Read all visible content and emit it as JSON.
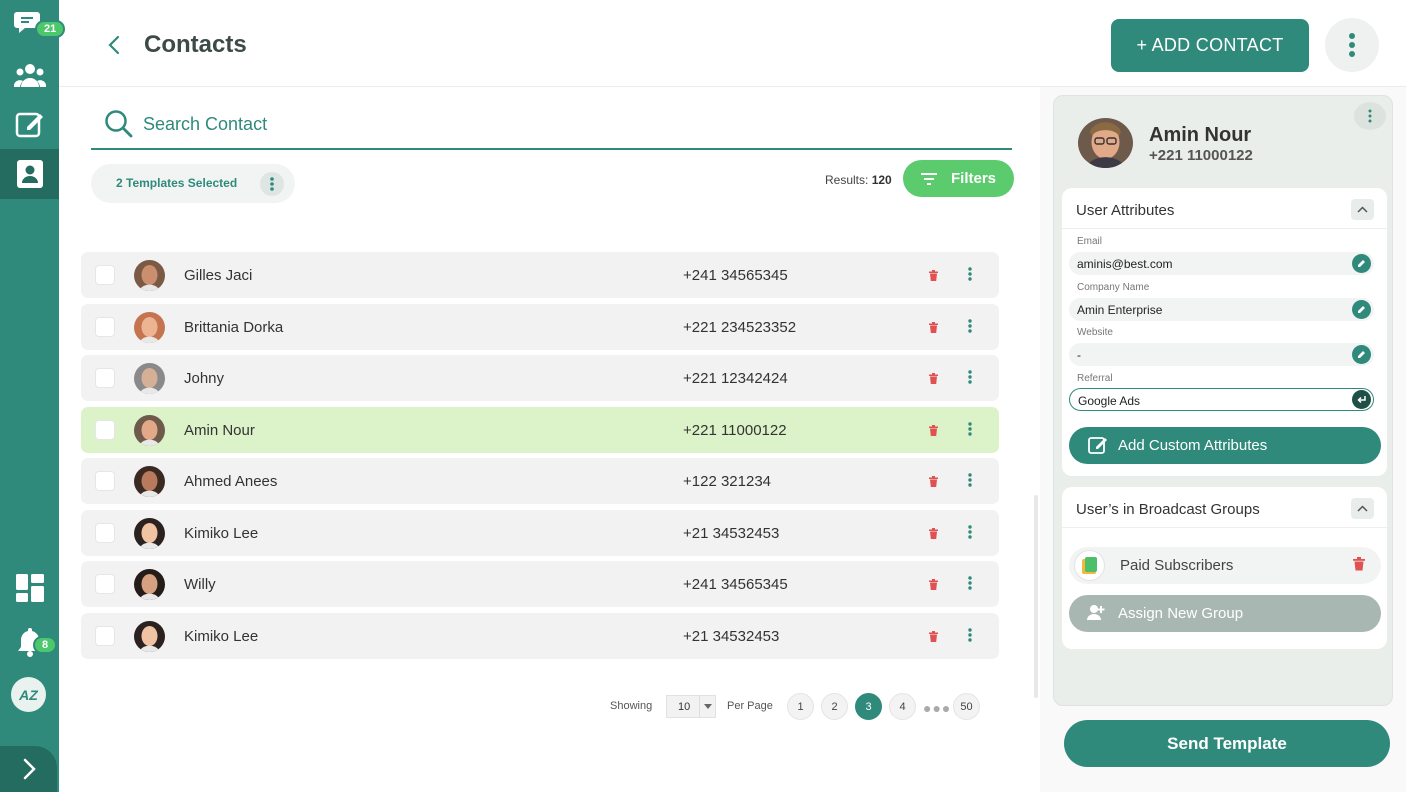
{
  "sidebar": {
    "chat_badge": "21",
    "notifications_badge": "8",
    "brand_initials": "AZ"
  },
  "header": {
    "title": "Contacts",
    "add_contact_label": "+ ADD CONTACT"
  },
  "search": {
    "placeholder": "Search Contact"
  },
  "selection": {
    "label": "2 Templates Selected"
  },
  "results": {
    "label": "Results:",
    "count": "120"
  },
  "filters_label": "Filters",
  "contacts": [
    {
      "name": "Gilles Jaci",
      "phone": "+241 34565345",
      "selected": false
    },
    {
      "name": "Brittania Dorka",
      "phone": "+221 234523352",
      "selected": false
    },
    {
      "name": "Johny",
      "phone": "+221 12342424",
      "selected": false
    },
    {
      "name": "Amin Nour",
      "phone": "+221 11000122",
      "selected": true
    },
    {
      "name": "Ahmed Anees",
      "phone": "+122 321234",
      "selected": false
    },
    {
      "name": "Kimiko Lee",
      "phone": "+21 34532453",
      "selected": false
    },
    {
      "name": "Willy",
      "phone": "+241 34565345",
      "selected": false
    },
    {
      "name": "Kimiko Lee",
      "phone": "+21 34532453",
      "selected": false
    }
  ],
  "pagination": {
    "showing_label": "Showing",
    "per_page_value": "10",
    "per_page_label": "Per Page",
    "pages": [
      "1",
      "2",
      "3",
      "4"
    ],
    "current_page": "3",
    "last_page": "50"
  },
  "profile": {
    "name": "Amin Nour",
    "phone": "+221 11000122",
    "attributes_title": "User Attributes",
    "fields": [
      {
        "label": "Email",
        "value": "aminis@best.com"
      },
      {
        "label": "Company Name",
        "value": "Amin Enterprise"
      },
      {
        "label": "Website",
        "value": "-"
      },
      {
        "label": "Referral",
        "value": "Google Ads"
      }
    ],
    "add_custom_label": "Add Custom Attributes",
    "groups_title": "User’s in Broadcast Groups",
    "groups": [
      {
        "name": "Paid Subscribers"
      }
    ],
    "assign_group_label": "Assign New Group"
  },
  "send_template_label": "Send Template",
  "colors": {
    "primary": "#2f8a7c",
    "accent_green": "#5ccb6d",
    "selected_row": "#dcf3ca",
    "danger": "#e05252"
  }
}
